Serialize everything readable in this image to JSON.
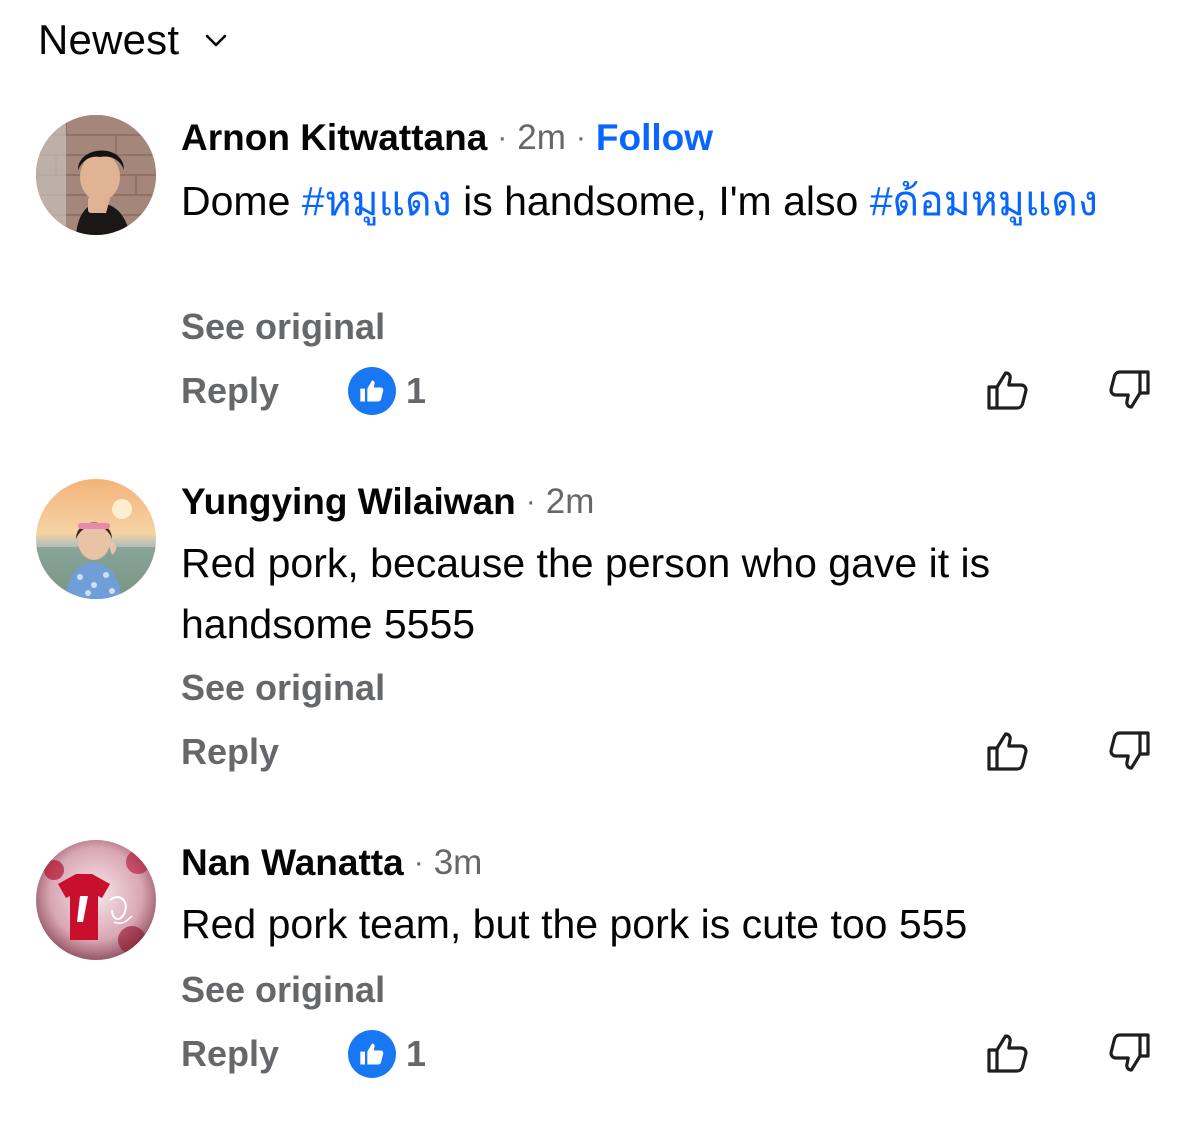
{
  "sort": {
    "label": "Newest",
    "icon": "chevron-down-icon"
  },
  "comments": [
    {
      "author": "Arnon Kitwattana",
      "separator": "·",
      "time": "2m",
      "follow_label": "Follow",
      "text_segments": [
        "Dome ",
        "#หมูแดง",
        " is handsome, I'm also ",
        "#ด้อมหมูแดง"
      ],
      "see_original": "See original",
      "reply_label": "Reply",
      "like_count": "1",
      "upvote_icon": "thumbs-up-outline-icon",
      "downvote_icon": "thumbs-down-outline-icon"
    },
    {
      "author": "Yungying Wilaiwan",
      "separator": "·",
      "time": "2m",
      "text": "Red pork, because the person who gave it is handsome 5555",
      "see_original": "See original",
      "reply_label": "Reply",
      "upvote_icon": "thumbs-up-outline-icon",
      "downvote_icon": "thumbs-down-outline-icon"
    },
    {
      "author": "Nan Wanatta",
      "separator": "·",
      "time": "3m",
      "text": "Red pork team, but the pork is cute too 555",
      "see_original": "See original",
      "reply_label": "Reply",
      "like_count": "1",
      "upvote_icon": "thumbs-up-outline-icon",
      "downvote_icon": "thumbs-down-outline-icon"
    }
  ],
  "colors": {
    "link_blue": "#0866ff",
    "like_badge": "#1877f2",
    "secondary_text": "#65676b",
    "primary_text": "#050505"
  }
}
